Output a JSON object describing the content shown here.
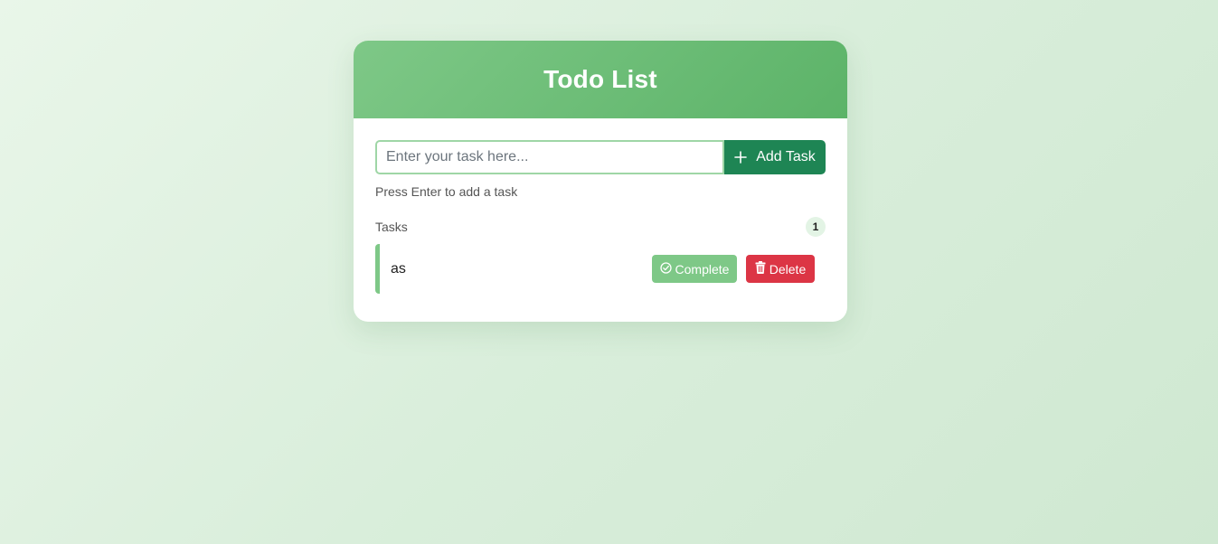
{
  "app": {
    "title": "Todo List"
  },
  "input": {
    "value": "",
    "placeholder": "Enter your task here...",
    "add_label": "Add Task",
    "add_icon": "plus-icon"
  },
  "hint": "Press Enter to add a task",
  "tasks_section": {
    "label": "Tasks",
    "count": "1"
  },
  "tasks": [
    {
      "text": "as",
      "complete_label": "Complete",
      "complete_icon": "check-circle-icon",
      "delete_label": "Delete",
      "delete_icon": "trash-icon"
    }
  ],
  "colors": {
    "header_gradient_start": "#7ec887",
    "header_gradient_end": "#5cb368",
    "add_button": "#1e8554",
    "complete_button": "#7ec887",
    "delete_button": "#dc3545",
    "task_border": "#7ec887"
  }
}
